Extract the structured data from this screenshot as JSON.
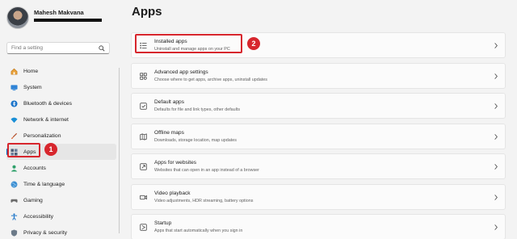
{
  "profile": {
    "name": "Mahesh Makvana"
  },
  "search": {
    "placeholder": "Find a setting"
  },
  "sidebar": {
    "items": [
      {
        "label": "Home",
        "icon": "home-icon"
      },
      {
        "label": "System",
        "icon": "system-icon"
      },
      {
        "label": "Bluetooth & devices",
        "icon": "bluetooth-icon"
      },
      {
        "label": "Network & internet",
        "icon": "network-icon"
      },
      {
        "label": "Personalization",
        "icon": "brush-icon"
      },
      {
        "label": "Apps",
        "icon": "apps-icon"
      },
      {
        "label": "Accounts",
        "icon": "accounts-icon"
      },
      {
        "label": "Time & language",
        "icon": "globe-icon"
      },
      {
        "label": "Gaming",
        "icon": "gaming-icon"
      },
      {
        "label": "Accessibility",
        "icon": "accessibility-icon"
      },
      {
        "label": "Privacy & security",
        "icon": "shield-icon"
      }
    ]
  },
  "main": {
    "title": "Apps",
    "cards": [
      {
        "title": "Installed apps",
        "desc": "Uninstall and manage apps on your PC",
        "icon": "list-icon"
      },
      {
        "title": "Advanced app settings",
        "desc": "Choose where to get apps, archive apps, uninstall updates",
        "icon": "advanced-apps-icon"
      },
      {
        "title": "Default apps",
        "desc": "Defaults for file and link types, other defaults",
        "icon": "default-apps-icon"
      },
      {
        "title": "Offline maps",
        "desc": "Downloads, storage location, map updates",
        "icon": "map-icon"
      },
      {
        "title": "Apps for websites",
        "desc": "Websites that can open in an app instead of a browser",
        "icon": "web-apps-icon"
      },
      {
        "title": "Video playback",
        "desc": "Video adjustments, HDR streaming, battery options",
        "icon": "video-icon"
      },
      {
        "title": "Startup",
        "desc": "Apps that start automatically when you sign in",
        "icon": "startup-icon"
      }
    ]
  },
  "callouts": {
    "first": "1",
    "second": "2"
  },
  "colors": {
    "accent": "#0067c0",
    "callout": "#d7262d"
  }
}
